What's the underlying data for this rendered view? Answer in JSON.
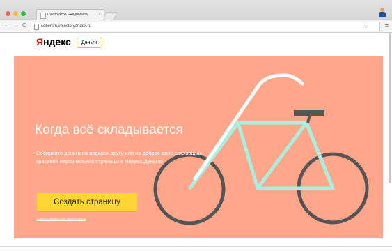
{
  "browser": {
    "tab_title": "Конструктор Ежедневной",
    "tab_close": "×",
    "url": "sobersm.vmeste.yandex.ru",
    "back": "←",
    "forward": "→",
    "reload": "C",
    "star": "☆",
    "menu": "≡"
  },
  "header": {
    "logo_first": "Я",
    "logo_rest": "ндекс",
    "money_badge": "Деньги"
  },
  "hero": {
    "title": "Когда всё складывается",
    "text": "Собирайте деньги на подарок другу или на доброе дело с помощью красивой персональной страницы в Яндекс.Деньгах",
    "cta_label": "Создать страницу",
    "small_link": "Сделать кнопку для своего сайта",
    "colors": {
      "background": "#ffa68b",
      "cta": "#ffd634",
      "frame": "#aaeee0",
      "wheels": "#555555",
      "handlebar": "#ffffff",
      "seat": "#555555"
    }
  }
}
